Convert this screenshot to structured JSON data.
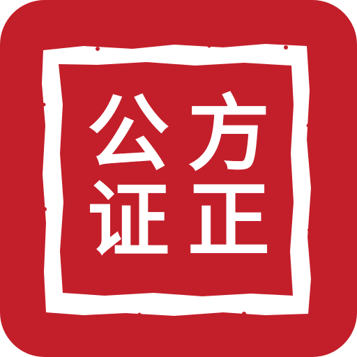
{
  "icon": {
    "name": "公证方正 app icon",
    "background_color": "#C31F2A",
    "seal_color": "#FFFFFF"
  },
  "seal": {
    "top_left": "公",
    "top_right": "方",
    "bottom_left": "证",
    "bottom_right": "正"
  }
}
